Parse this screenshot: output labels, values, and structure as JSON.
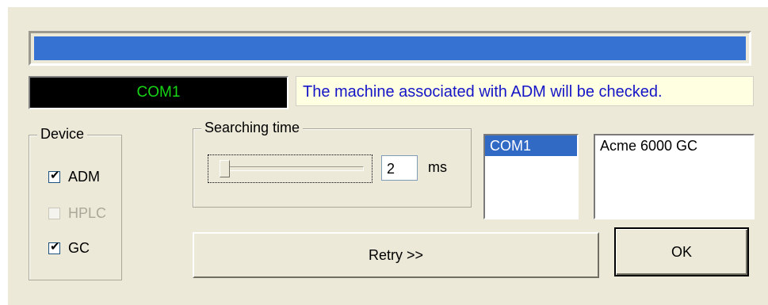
{
  "progress": {
    "value": 1.0,
    "color": "#3572d1"
  },
  "port_display": {
    "text": "COM1",
    "text_color": "#17d417"
  },
  "status_message": {
    "text": "The machine associated with ADM will be checked.",
    "text_color": "#1515c8"
  },
  "device_group": {
    "label": "Device",
    "items": [
      {
        "label": "ADM",
        "checked": true,
        "enabled": true
      },
      {
        "label": "HPLC",
        "checked": false,
        "enabled": false
      },
      {
        "label": "GC",
        "checked": true,
        "enabled": true
      }
    ]
  },
  "searching_time": {
    "label": "Searching time",
    "slider_value": 2,
    "value": "2",
    "unit": "ms"
  },
  "port_list": {
    "items": [
      {
        "label": "COM1",
        "selected": true
      }
    ]
  },
  "instrument_list": {
    "items": [
      {
        "label": "Acme 6000 GC",
        "selected": false
      }
    ]
  },
  "buttons": {
    "retry_label": "Retry >>",
    "ok_label": "OK"
  },
  "check_glyph": "✔"
}
